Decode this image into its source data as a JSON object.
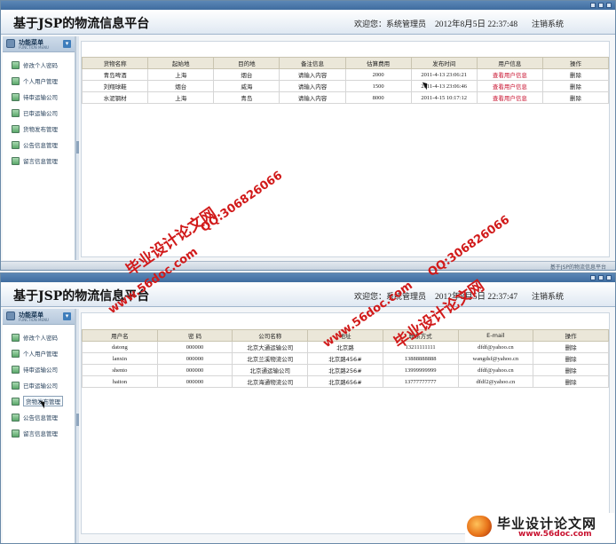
{
  "app": {
    "site_title": "基于JSP的物流信息平台",
    "welcome": "欢迎您：系统管理员",
    "logout": "注销系统",
    "footer_text": "基于JSP的物流信息平台"
  },
  "sidebar": {
    "header_label": "功能菜单",
    "header_sub": "FUNCTION MENU",
    "toggle_icon": "collapse-icon",
    "items": [
      {
        "label": "修改个人密码",
        "icon": "key-icon"
      },
      {
        "label": "个人用户管理",
        "icon": "user-icon"
      },
      {
        "label": "待审运输公司",
        "icon": "pending-company-icon"
      },
      {
        "label": "已审运输公司",
        "icon": "approved-company-icon"
      },
      {
        "label": "货物发布管理",
        "icon": "cargo-icon"
      },
      {
        "label": "公告信息管理",
        "icon": "notice-icon"
      },
      {
        "label": "留言信息管理",
        "icon": "message-icon"
      }
    ]
  },
  "screen1": {
    "datetime": "2012年8月5日  22:37:48",
    "table": {
      "columns": [
        "货物名称",
        "起始地",
        "目的地",
        "备注信息",
        "估算费用",
        "发布时间",
        "用户信息",
        "操作"
      ],
      "rows": [
        {
          "name": "青岛啤酒",
          "from": "上海",
          "to": "烟台",
          "note": "请输入内容",
          "cost": "2000",
          "time": "2011-4-13 23:06:21",
          "user": "查看用户信息",
          "op": "删除"
        },
        {
          "name": "刘翔球鞋",
          "from": "烟台",
          "to": "威海",
          "note": "请输入内容",
          "cost": "1500",
          "time": "2011-4-13 23:06:46",
          "user": "查看用户信息",
          "op": "删除"
        },
        {
          "name": "水泥钢材",
          "from": "上海",
          "to": "青岛",
          "note": "请输入内容",
          "cost": "8000",
          "time": "2011-4-15 10:17:12",
          "user": "查看用户信息",
          "op": "删除"
        }
      ]
    }
  },
  "screen2": {
    "datetime": "2012年8月5日  22:37:47",
    "active_menu_index": 4,
    "table": {
      "columns": [
        "用户名",
        "密  码",
        "公司名称",
        "地址",
        "联系方式",
        "E-mail",
        "操作"
      ],
      "rows": [
        {
          "user": "datong",
          "pwd": "000000",
          "company": "北京大通运输公司",
          "addr": "北京路",
          "phone": "13211111111",
          "email": "dfdf@yahoo.cn",
          "op": "删除"
        },
        {
          "user": "lanxin",
          "pwd": "000000",
          "company": "北京兰溪物流公司",
          "addr": "北京路456#",
          "phone": "13888888888",
          "email": "wangdsf@yahoo.cn",
          "op": "删除"
        },
        {
          "user": "shento",
          "pwd": "000000",
          "company": "北京通运输公司",
          "addr": "北京路256#",
          "phone": "13999999999",
          "email": "dfdf@yahoo.cn",
          "op": "删除"
        },
        {
          "user": "haiton",
          "pwd": "000000",
          "company": "北京海通物流公司",
          "addr": "北京路656#",
          "phone": "13777777777",
          "email": "dfdf2@yahoo.cn",
          "op": "删除"
        }
      ]
    }
  },
  "watermarks": {
    "cn": "毕业设计论文网",
    "qq": "QQ:306826066",
    "url": "www.56doc.com"
  },
  "brand_logo": {
    "title": "毕业设计论文网",
    "url": "www.56doc.com"
  }
}
